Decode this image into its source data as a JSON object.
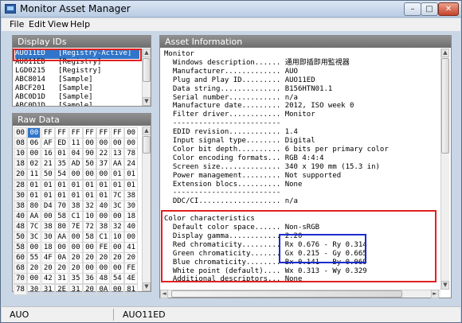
{
  "window": {
    "title": "Monitor Asset Manager",
    "close_glyph": "✕",
    "max_glyph": "□",
    "min_glyph": "–"
  },
  "menu": [
    "File",
    "Edit",
    "View",
    "Help"
  ],
  "display_ids": {
    "header": "Display IDs",
    "items": [
      "AUO11ED   [Registry-Active]",
      "AUO11ED   [Registry]",
      "LGD0215   [Registry]",
      "ABC8014   [Sample]",
      "ABCF201   [Sample]",
      "ABC0D1D   [Sample]",
      "ABC0D1D   [Sample]"
    ]
  },
  "raw_data": {
    "header": "Raw Data",
    "rows": [
      [
        "00",
        "00",
        "FF",
        "FF",
        "FF",
        "FF",
        "FF",
        "FF",
        "00"
      ],
      [
        "08",
        "06",
        "AF",
        "ED",
        "11",
        "00",
        "00",
        "00",
        "00"
      ],
      [
        "10",
        "00",
        "16",
        "01",
        "04",
        "90",
        "22",
        "13",
        "78"
      ],
      [
        "18",
        "02",
        "21",
        "35",
        "AD",
        "50",
        "37",
        "AA",
        "24"
      ],
      [
        "20",
        "11",
        "50",
        "54",
        "00",
        "00",
        "00",
        "01",
        "01"
      ],
      [
        "28",
        "01",
        "01",
        "01",
        "01",
        "01",
        "01",
        "01",
        "01"
      ],
      [
        "30",
        "01",
        "01",
        "01",
        "01",
        "01",
        "01",
        "7C",
        "38"
      ],
      [
        "38",
        "80",
        "D4",
        "70",
        "38",
        "32",
        "40",
        "3C",
        "30"
      ],
      [
        "40",
        "AA",
        "00",
        "58",
        "C1",
        "10",
        "00",
        "00",
        "18"
      ],
      [
        "48",
        "7C",
        "38",
        "80",
        "7E",
        "72",
        "38",
        "32",
        "40"
      ],
      [
        "50",
        "3C",
        "30",
        "AA",
        "00",
        "58",
        "C1",
        "10",
        "00"
      ],
      [
        "58",
        "00",
        "18",
        "00",
        "00",
        "00",
        "FE",
        "00",
        "41"
      ],
      [
        "60",
        "55",
        "4F",
        "0A",
        "20",
        "20",
        "20",
        "20",
        "20"
      ],
      [
        "68",
        "20",
        "20",
        "20",
        "20",
        "00",
        "00",
        "00",
        "FE"
      ],
      [
        "70",
        "00",
        "42",
        "31",
        "35",
        "36",
        "48",
        "54",
        "4E"
      ],
      [
        "78",
        "30",
        "31",
        "2E",
        "31",
        "20",
        "0A",
        "00",
        "81"
      ]
    ]
  },
  "asset_info": {
    "header": "Asset Information",
    "lines": [
      "Monitor",
      "  Windows description...... 通用即插即用監視器",
      "  Manufacturer............. AUO",
      "  Plug and Play ID......... AUO11ED",
      "  Data string.............. B156HTN01.1",
      "  Serial number............ n/a",
      "  Manufacture date......... 2012, ISO week 0",
      "  Filter driver............ Monitor",
      "  -------------------------",
      "  EDID revision............ 1.4",
      "  Input signal type........ Digital",
      "  Color bit depth.......... 6 bits per primary color",
      "  Color encoding formats... RGB 4:4:4",
      "  Screen size.............. 340 x 190 mm (15.3 in)",
      "  Power management......... Not supported",
      "  Extension blocs.......... None",
      "  -------------------------",
      "  DDC/CI................... n/a",
      "",
      "Color characteristics",
      "  Default color space...... Non-sRGB",
      "  Display gamma............ 2.20",
      "  Red chromaticity......... Rx 0.676 - Ry 0.314",
      "  Green chromaticity....... Gx 0.215 - Gy 0.665",
      "  Blue chromaticity........ Bx 0.141 - By 0.069",
      "  White point (default).... Wx 0.313 - Wy 0.329",
      "  Additional descriptors... None"
    ]
  },
  "status": {
    "left": "AUO",
    "right": "AUO11ED"
  },
  "colors": {
    "highlight": "#3075c9",
    "red_box": "#e0201f",
    "blue_box": "#1b2bd0"
  }
}
